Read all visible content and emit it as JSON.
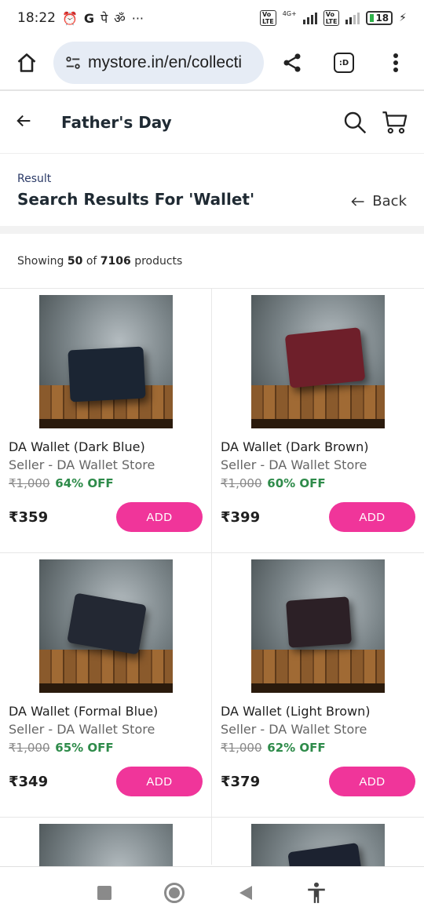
{
  "status_bar": {
    "time": "18:22",
    "icons": [
      "alarm-icon",
      "google-icon",
      "pe-icon",
      "hindi-keyboard-icon",
      "more-dots-icon"
    ],
    "net_type": "4G+",
    "battery": "18"
  },
  "browser": {
    "url": "mystore.in/en/collecti",
    "tabs_label": ":D"
  },
  "header": {
    "title": "Father's Day"
  },
  "result": {
    "label": "Result",
    "heading": "Search Results For 'Wallet'",
    "back_label": "Back"
  },
  "showing": {
    "prefix": "Showing",
    "shown": "50",
    "of": "of",
    "total": "7106",
    "suffix": "products"
  },
  "products": [
    {
      "name": "DA Wallet (Dark Blue)",
      "seller": "Seller - DA Wallet Store",
      "mrp": "₹1,000",
      "discount": "64% OFF",
      "price": "₹359",
      "add_label": "ADD",
      "wallet_color": "#1b2533"
    },
    {
      "name": "DA Wallet (Dark Brown)",
      "seller": "Seller - DA Wallet Store",
      "mrp": "₹1,000",
      "discount": "60% OFF",
      "price": "₹399",
      "add_label": "ADD",
      "wallet_color": "#6e1f2a"
    },
    {
      "name": "DA Wallet (Formal Blue)",
      "seller": "Seller - DA Wallet Store",
      "mrp": "₹1,000",
      "discount": "65% OFF",
      "price": "₹349",
      "add_label": "ADD",
      "wallet_color": "#232833"
    },
    {
      "name": "DA Wallet (Light Brown)",
      "seller": "Seller - DA Wallet Store",
      "mrp": "₹1,000",
      "discount": "62% OFF",
      "price": "₹379",
      "add_label": "ADD",
      "wallet_color": "#2c2026"
    }
  ],
  "colors": {
    "accent_pink": "#f0359a",
    "discount_green": "#2e8b4a",
    "url_bar_bg": "#e6ecf5"
  }
}
